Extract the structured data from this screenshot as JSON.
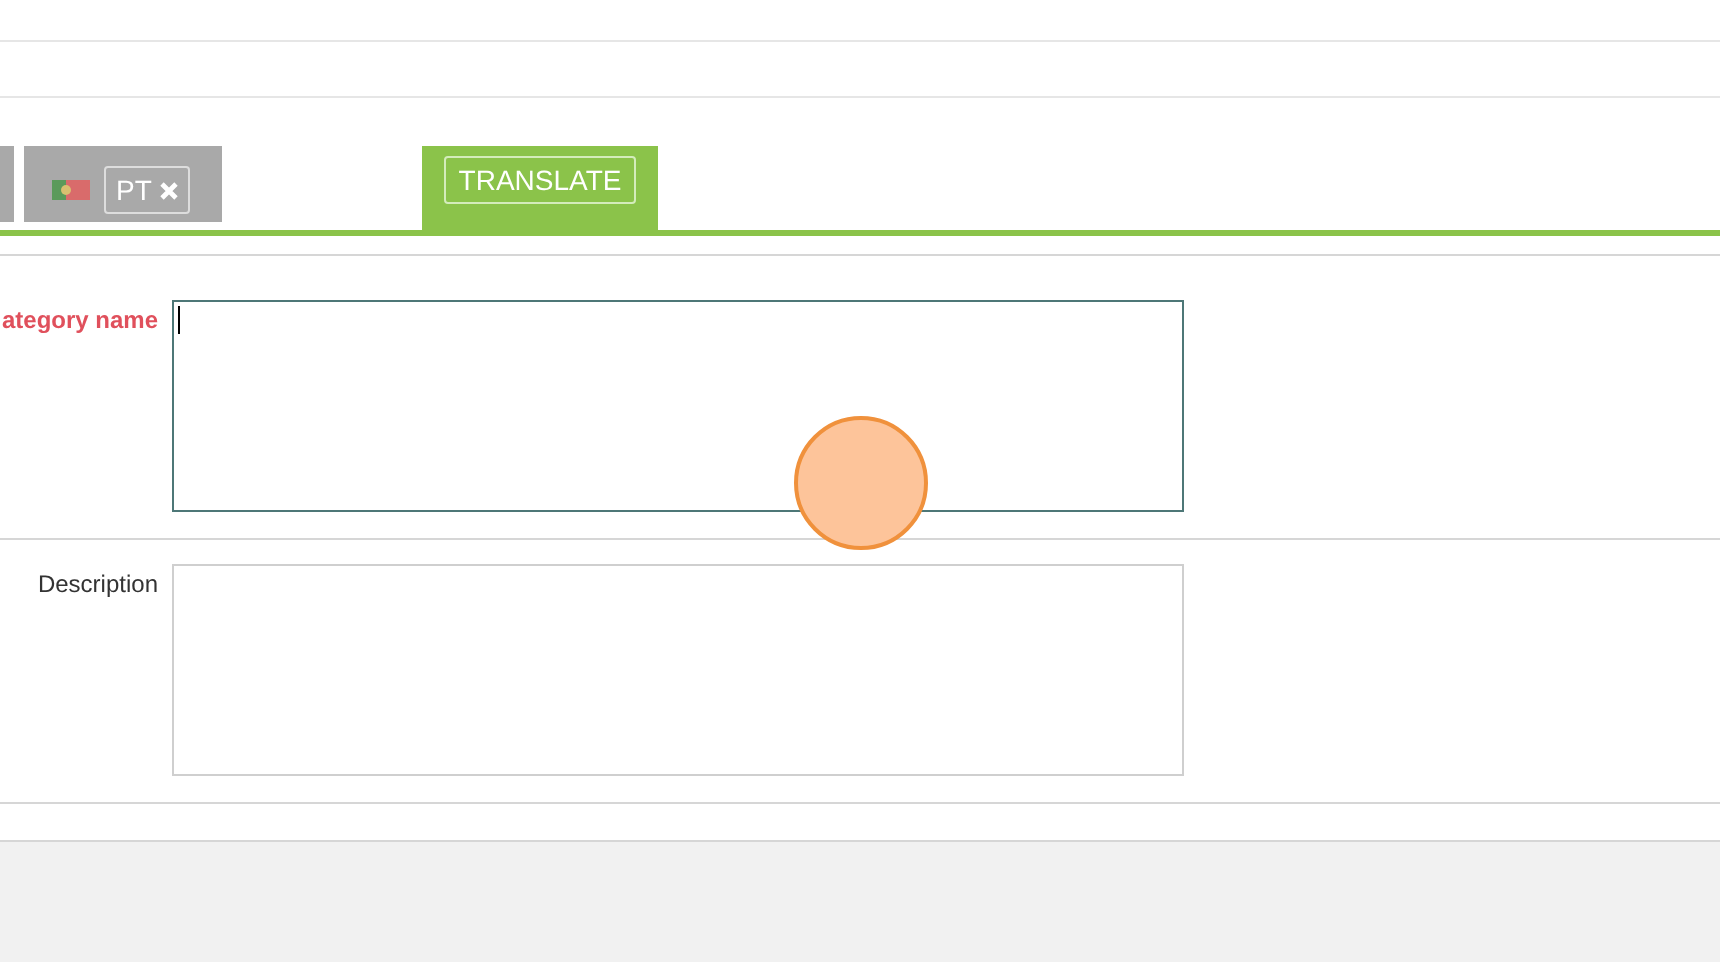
{
  "tabs": [
    {
      "kind": "language",
      "label": "PT"
    },
    {
      "kind": "action",
      "label": "TRANSLATE"
    }
  ],
  "fields": [
    {
      "label": "ategory name",
      "required": true,
      "focused": true
    },
    {
      "label": "Description",
      "required": false,
      "focused": false
    }
  ]
}
